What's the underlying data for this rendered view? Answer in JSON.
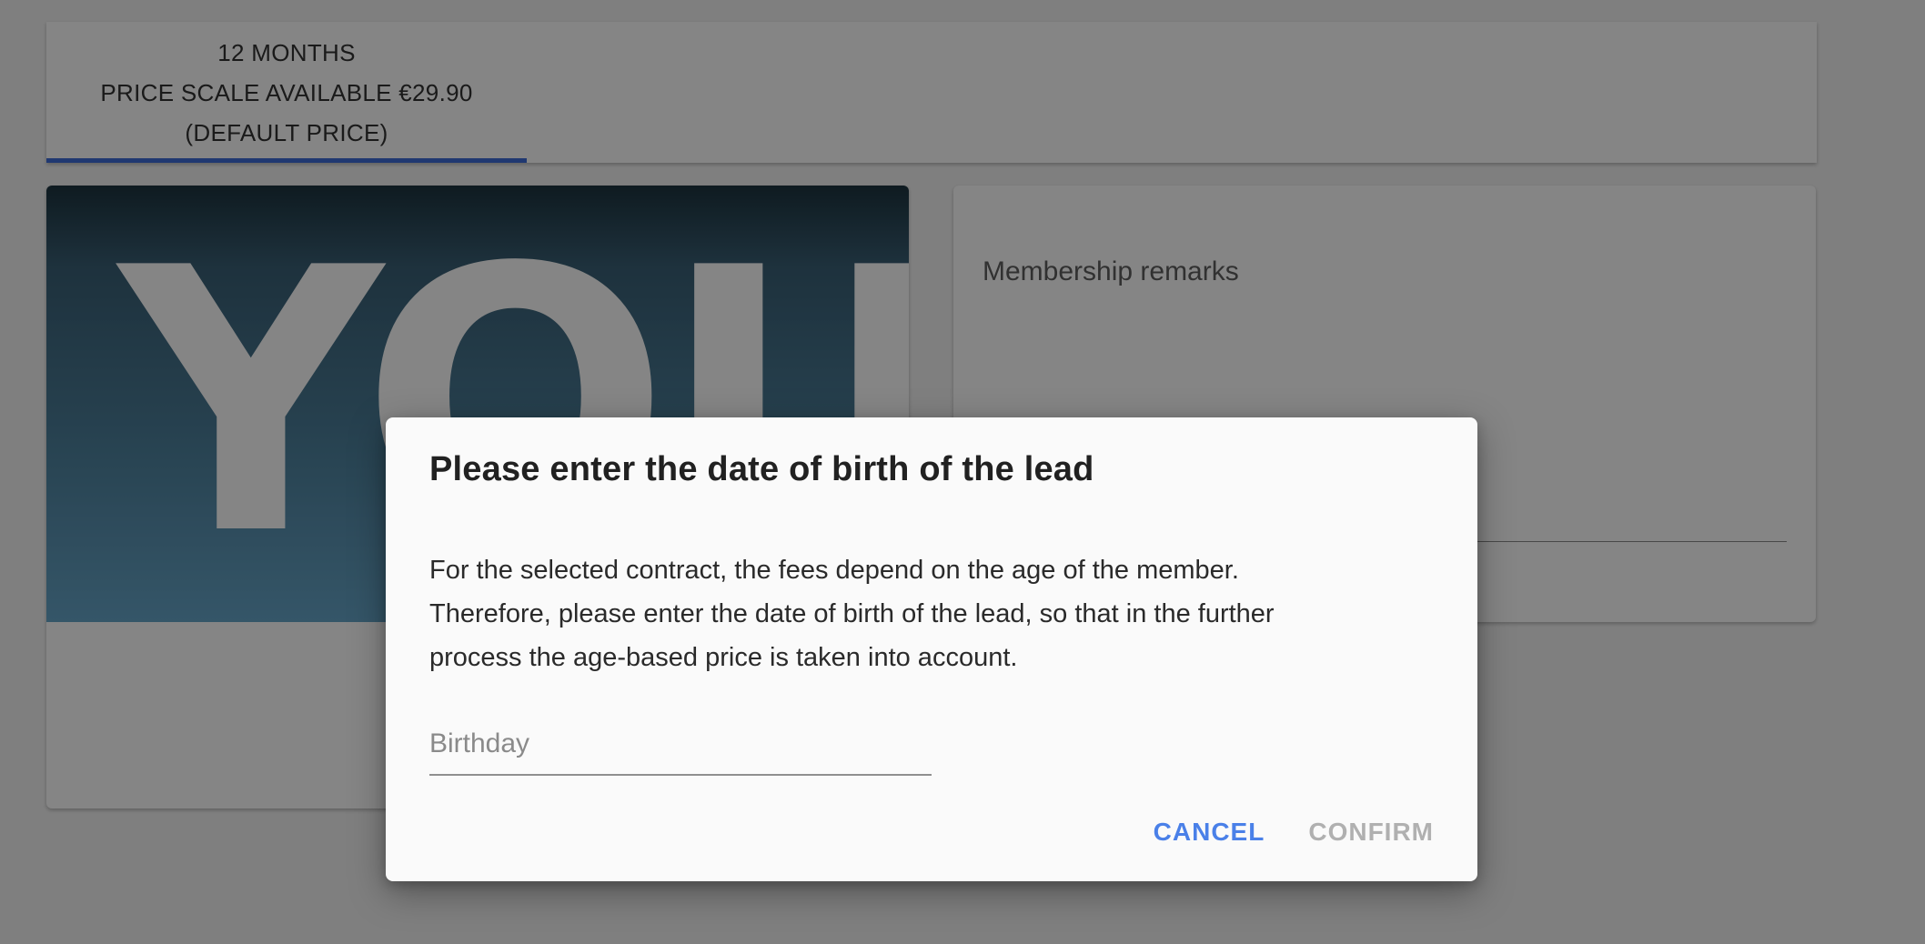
{
  "tabs": [
    {
      "line1": "12 MONTHS",
      "line2": "PRICE SCALE AVAILABLE €29.90",
      "line3": "(DEFAULT PRICE)",
      "selected": true
    }
  ],
  "image_card": {
    "banner_text": "YOU"
  },
  "remarks": {
    "label": "Membership remarks",
    "value": ""
  },
  "dialog": {
    "title": "Please enter the date of birth of the lead",
    "body_line1": "For the selected contract, the fees depend on the age of the member.",
    "body_line2": "Therefore, please enter the date of birth of the lead, so that in the further",
    "body_line3": "process the age-based price is taken into account.",
    "birthday_placeholder": "Birthday",
    "birthday_value": "",
    "cancel_label": "CANCEL",
    "confirm_label": "CONFIRM",
    "confirm_enabled": false
  },
  "colors": {
    "accent": "#4a80e8",
    "tab_indicator": "#3f6bd8",
    "disabled_text": "#b0b0b0",
    "scrim": "rgba(0,0,0,0.48)"
  }
}
